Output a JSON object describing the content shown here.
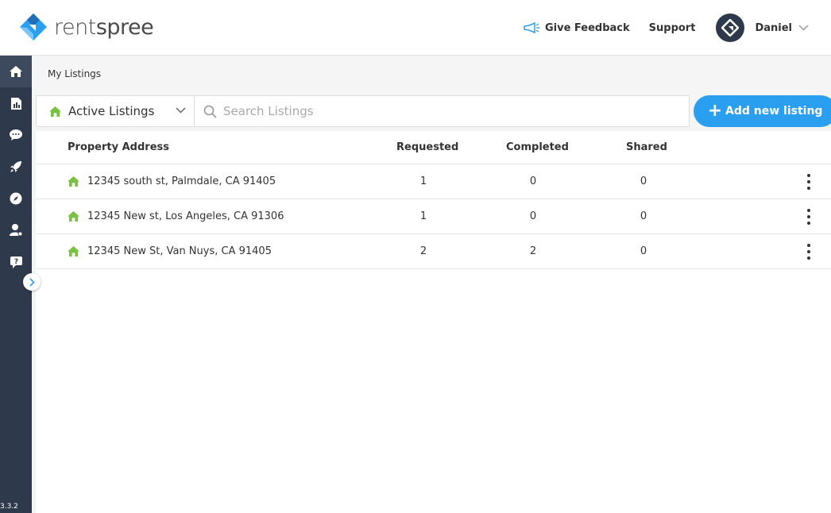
{
  "brand": {
    "name_light": "rent",
    "name_bold": "spree",
    "accent": "#2a9ff0",
    "dark": "#2e3a4c"
  },
  "header": {
    "feedback_label": "Give Feedback",
    "support_label": "Support",
    "user_name": "Daniel"
  },
  "sidebar": {
    "items": [
      {
        "icon": "home-icon"
      },
      {
        "icon": "report-icon"
      },
      {
        "icon": "chat-icon"
      },
      {
        "icon": "rocket-icon"
      },
      {
        "icon": "compass-icon"
      },
      {
        "icon": "user-settings-icon"
      },
      {
        "icon": "help-chat-icon"
      }
    ],
    "version": "3.3.2"
  },
  "breadcrumb": "My Listings",
  "toolbar": {
    "filter_label": "Active Listings",
    "search_placeholder": "Search Listings",
    "add_label": "Add new listing"
  },
  "table": {
    "headers": {
      "address": "Property Address",
      "requested": "Requested",
      "completed": "Completed",
      "shared": "Shared"
    },
    "rows": [
      {
        "address": "12345 south st, Palmdale, CA 91405",
        "requested": "1",
        "completed": "0",
        "shared": "0"
      },
      {
        "address": "12345 New st, Los Angeles, CA 91306",
        "requested": "1",
        "completed": "0",
        "shared": "0"
      },
      {
        "address": "12345 New St, Van Nuys, CA 91405",
        "requested": "2",
        "completed": "2",
        "shared": "0"
      }
    ]
  }
}
